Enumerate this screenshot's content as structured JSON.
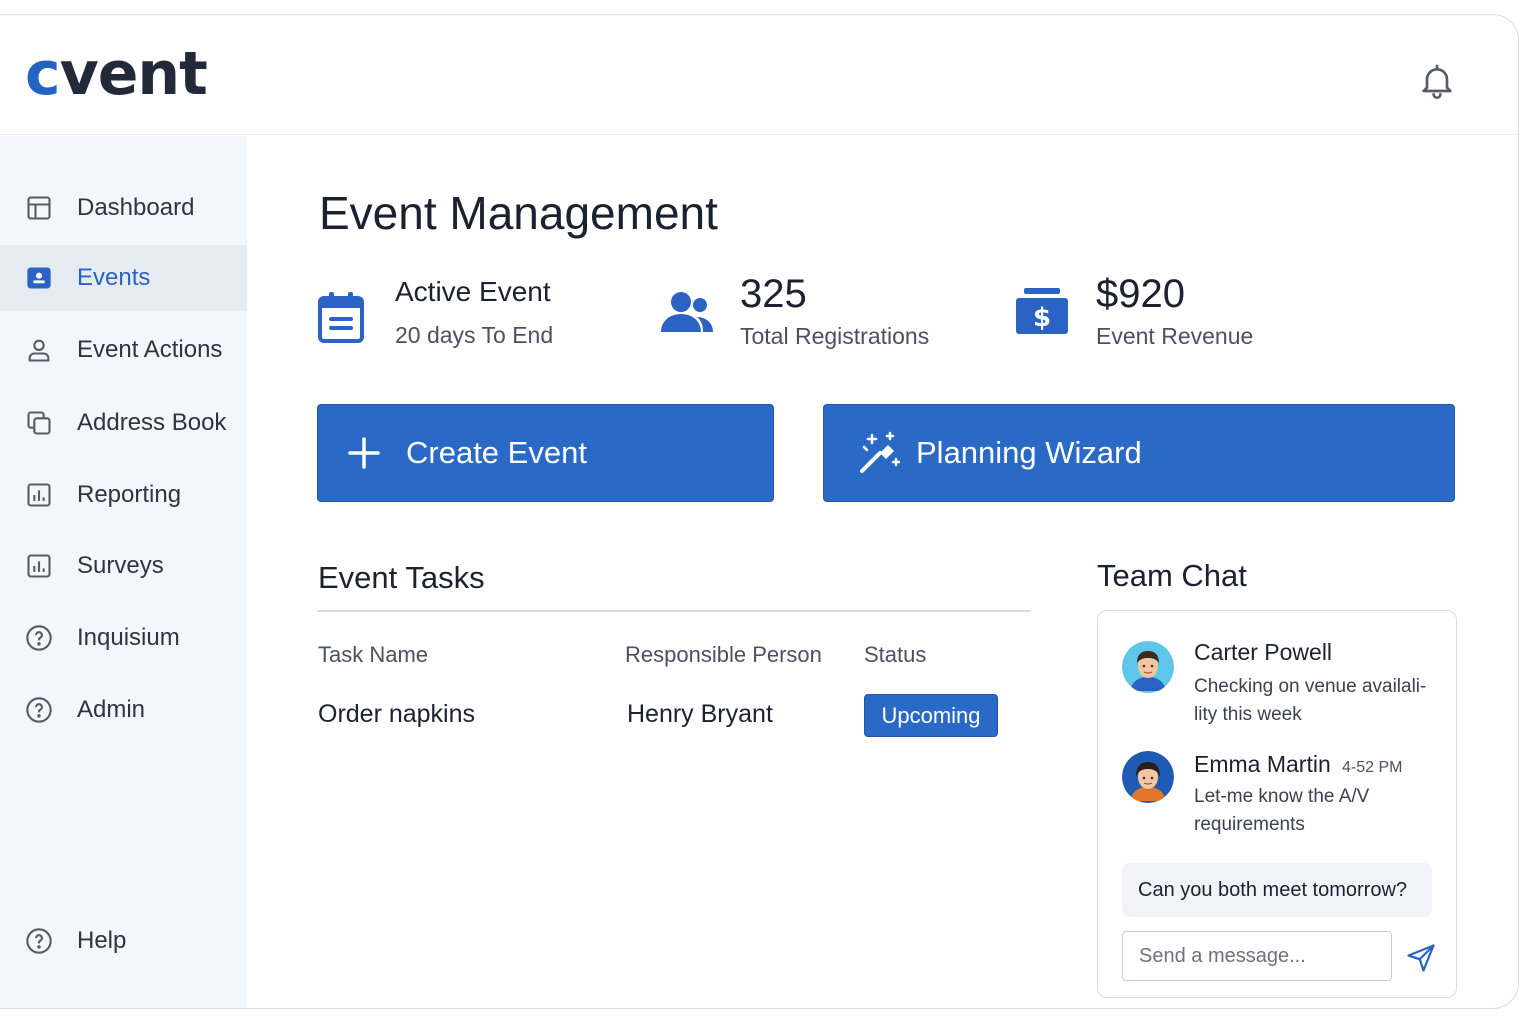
{
  "header": {
    "logo_accent": "c",
    "logo_rest": "vent"
  },
  "sidebar": {
    "items": [
      {
        "label": "Dashboard",
        "icon": "layout-icon"
      },
      {
        "label": "Events",
        "icon": "calendar-badge-icon",
        "active": true
      },
      {
        "label": "Event Actions",
        "icon": "user-icon"
      },
      {
        "label": "Address Book",
        "icon": "copy-icon"
      },
      {
        "label": "Reporting",
        "icon": "bar-chart-icon"
      },
      {
        "label": "Surveys",
        "icon": "bar-chart-icon"
      },
      {
        "label": "Inquisium",
        "icon": "help-circle-icon"
      },
      {
        "label": "Admin",
        "icon": "help-circle-icon"
      }
    ],
    "help": {
      "label": "Help",
      "icon": "help-circle-icon"
    }
  },
  "main": {
    "title": "Event Management",
    "stats": {
      "active": {
        "title": "Active Event",
        "subtitle": "20 days To End"
      },
      "registrations": {
        "value": "325",
        "label": "Total Registrations"
      },
      "revenue": {
        "value": "$920",
        "label": "Event Revenue"
      }
    },
    "actions": {
      "create": "Create Event",
      "wizard": "Planning Wizard"
    },
    "tasks": {
      "title": "Event Tasks",
      "columns": [
        "Task Name",
        "Responsible Person",
        "Status"
      ],
      "rows": [
        {
          "task": "Order napkins",
          "person": "Henry Bryant",
          "status": "Upcoming"
        }
      ]
    },
    "chat": {
      "title": "Team Chat",
      "messages": [
        {
          "name": "Carter Powell",
          "time": "",
          "text": "Checking on venue availa­li-lity this week"
        },
        {
          "name": "Emma Martin",
          "time": "4-52 PM",
          "text": "Let-me know the A/V requirements"
        }
      ],
      "pending": "Can you both meet tomorrow?",
      "placeholder": "Send a message..."
    }
  },
  "colors": {
    "accent": "#2a6ac6",
    "sidebar_bg": "#f3f7fb",
    "active_bg": "#e6ebf2"
  }
}
